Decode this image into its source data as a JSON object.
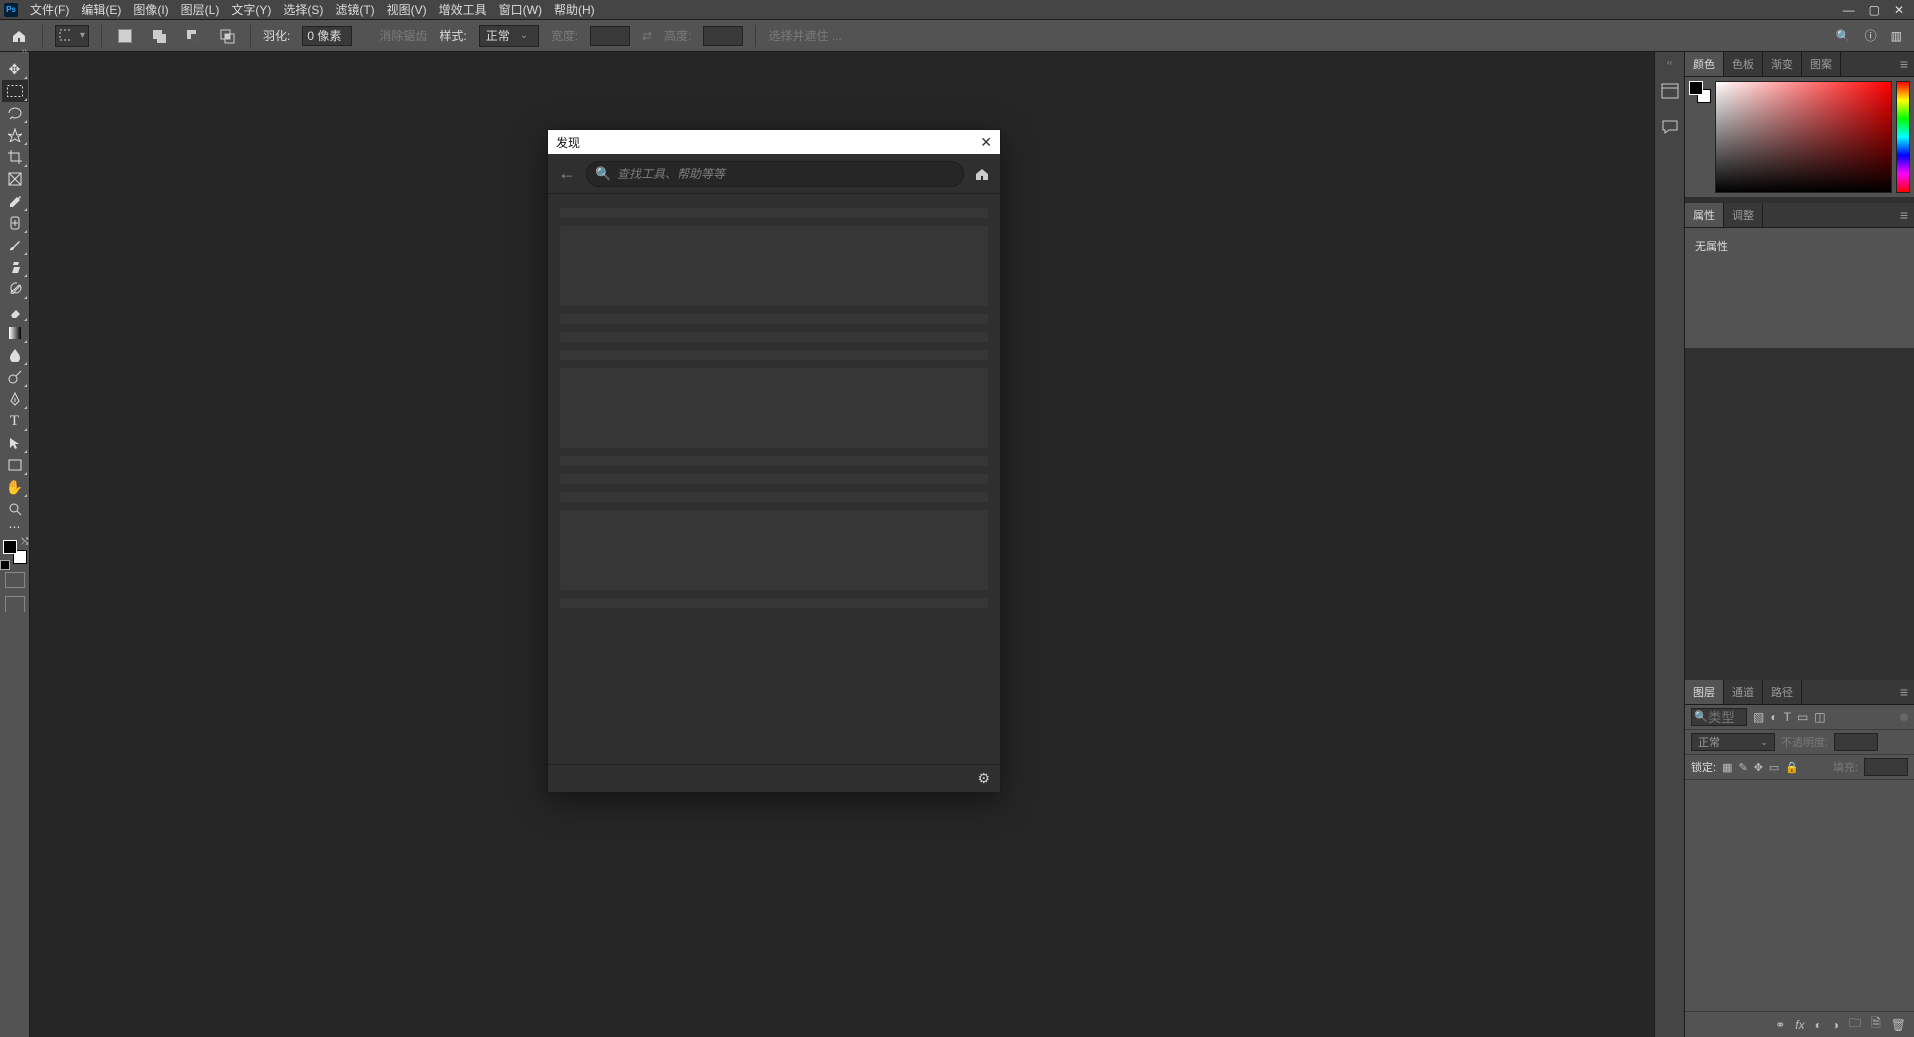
{
  "menus": [
    "文件(F)",
    "编辑(E)",
    "图像(I)",
    "图层(L)",
    "文字(Y)",
    "选择(S)",
    "滤镜(T)",
    "视图(V)",
    "增效工具",
    "窗口(W)",
    "帮助(H)"
  ],
  "options": {
    "feather_label": "羽化:",
    "feather_value": "0 像素",
    "antialias": "消除锯齿",
    "style_label": "样式:",
    "style_value": "正常",
    "width_label": "宽度:",
    "width_value": "",
    "height_label": "高度:",
    "height_value": "",
    "mask_select": "选择并遮住 ..."
  },
  "tools": [
    {
      "name": "move",
      "glyph": "✥"
    },
    {
      "name": "rect-marquee",
      "glyph": "▭",
      "active": true
    },
    {
      "name": "lasso",
      "glyph": "⊃"
    },
    {
      "name": "quick-select",
      "glyph": "✎"
    },
    {
      "name": "crop",
      "glyph": "⟂"
    },
    {
      "name": "frame",
      "glyph": "✕"
    },
    {
      "name": "eyedropper",
      "glyph": "✎"
    },
    {
      "name": "healing",
      "glyph": "✚"
    },
    {
      "name": "brush",
      "glyph": "✐"
    },
    {
      "name": "clone",
      "glyph": "⌁"
    },
    {
      "name": "history-brush",
      "glyph": "⟲"
    },
    {
      "name": "eraser",
      "glyph": "◧"
    },
    {
      "name": "gradient",
      "glyph": "▦"
    },
    {
      "name": "blur",
      "glyph": "●"
    },
    {
      "name": "dodge",
      "glyph": "◐"
    },
    {
      "name": "pen",
      "glyph": "✒"
    },
    {
      "name": "type",
      "glyph": "T"
    },
    {
      "name": "path-select",
      "glyph": "↖"
    },
    {
      "name": "rect",
      "glyph": "□"
    },
    {
      "name": "hand",
      "glyph": "✋"
    },
    {
      "name": "zoom",
      "glyph": "🔍"
    },
    {
      "name": "more",
      "glyph": "⋯"
    }
  ],
  "rail_icons": [
    {
      "name": "history",
      "glyph": "▭"
    },
    {
      "name": "comments",
      "glyph": "💬"
    }
  ],
  "panel_colors": {
    "tabs": [
      "颜色",
      "色板",
      "渐变",
      "图案"
    ]
  },
  "panel_props": {
    "tabs": [
      "属性",
      "调整"
    ],
    "no_props": "无属性"
  },
  "panel_layers": {
    "tabs": [
      "图层",
      "通道",
      "路径"
    ],
    "kind_placeholder": "类型",
    "blend": "正常",
    "opacity_label": "不透明度:",
    "opacity_value": "",
    "lock_label": "锁定:",
    "fill_label": "填充:",
    "fill_value": ""
  },
  "discover": {
    "title": "发现",
    "search_placeholder": "查找工具、帮助等等"
  }
}
